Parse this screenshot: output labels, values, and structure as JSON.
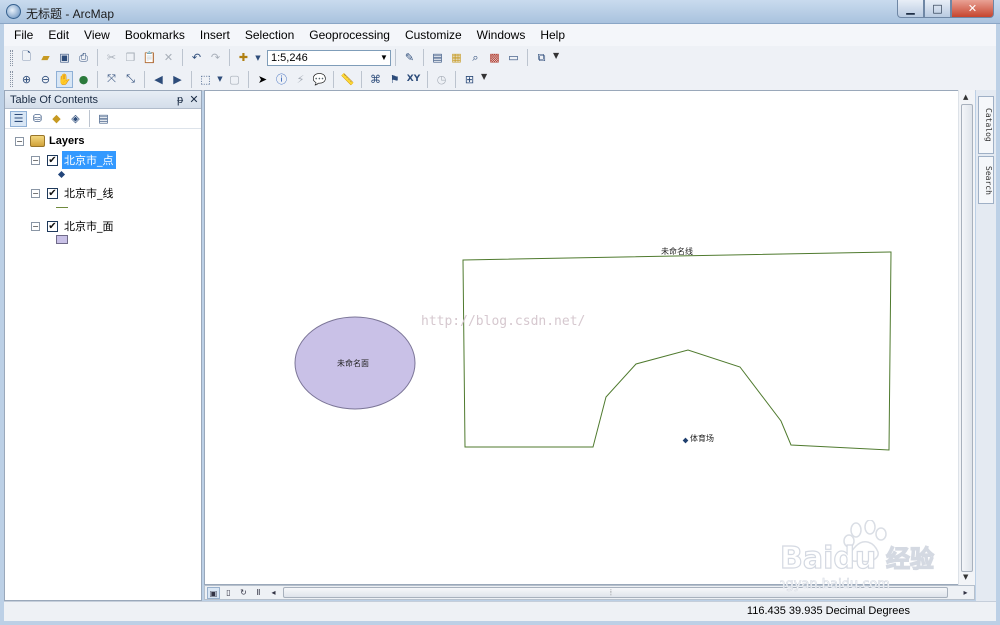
{
  "window": {
    "title": "无标题 - ArcMap",
    "buttons": {
      "minimize": "▁",
      "maximize": "□",
      "close": "✕"
    }
  },
  "menu": [
    "File",
    "Edit",
    "View",
    "Bookmarks",
    "Insert",
    "Selection",
    "Geoprocessing",
    "Customize",
    "Windows",
    "Help"
  ],
  "toolbar": {
    "scale": "1:5,246"
  },
  "toc": {
    "title": "Table Of Contents",
    "root_label": "Layers",
    "layers": [
      {
        "name": "北京市_点",
        "checked": true,
        "selected": true,
        "symbol": "point"
      },
      {
        "name": "北京市_线",
        "checked": true,
        "selected": false,
        "symbol": "line"
      },
      {
        "name": "北京市_面",
        "checked": true,
        "selected": false,
        "symbol": "polygon"
      }
    ]
  },
  "map": {
    "polygon_label": "未命名面",
    "line_label": "未命名线",
    "point_label": "体育场",
    "watermark_url": "http://blog.csdn.net/",
    "colors": {
      "polygon_fill": "#c9c1e7",
      "polygon_stroke": "#7b7597",
      "line": "#4f7a2e",
      "point": "#1f3f6e"
    }
  },
  "dock": {
    "catalog": "Catalog",
    "search": "Search"
  },
  "status": {
    "coordinates": "116.435  39.935 Decimal Degrees"
  },
  "watermark": {
    "brand": "Baidu",
    "brand_cn": "经验",
    "site": "jingyan.baidu.com"
  }
}
